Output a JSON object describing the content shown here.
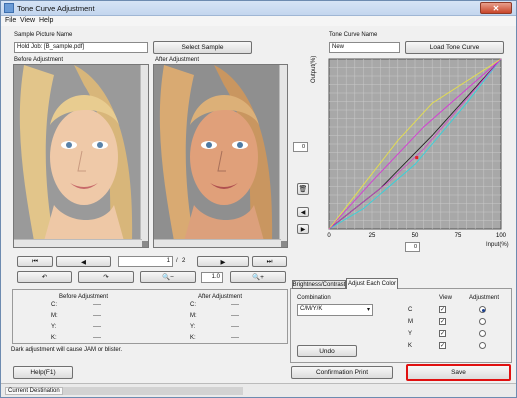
{
  "window": {
    "title": "Tone Curve Adjustment",
    "close_glyph": "✕"
  },
  "menu": {
    "file": "File",
    "view": "View",
    "help": "Help"
  },
  "sample": {
    "label": "Sample Picture Name",
    "value": "Hold Job: [B_sample.pdf]",
    "button": "Select Sample"
  },
  "tone": {
    "label": "Tone Curve Name",
    "value": "New",
    "button": "Load Tone Curve"
  },
  "images": {
    "before": "Before Adjustment",
    "after": "After Adjustment"
  },
  "nav": {
    "first": "⏮",
    "prev": "◀",
    "page_current": "1",
    "page_sep": "/",
    "page_total": "2",
    "next": "▶",
    "last": "⏭"
  },
  "tools": {
    "rotate_left": "↶",
    "rotate_right": "↷",
    "zoom_out": "🔍−",
    "zoom_value": "1.0",
    "zoom_in": "🔍+"
  },
  "values_table": {
    "before_header": "Before Adjustment",
    "after_header": "After Adjustment",
    "rows": [
      {
        "ch": "C:",
        "before": "----",
        "after": "----"
      },
      {
        "ch": "M:",
        "before": "----",
        "after": "----"
      },
      {
        "ch": "Y:",
        "before": "----",
        "after": "----"
      },
      {
        "ch": "K:",
        "before": "----",
        "after": "----"
      }
    ]
  },
  "warning": "Dark adjustment will cause JAM or blister.",
  "graph": {
    "y_label": "Output(%)",
    "x_label": "Input(%)",
    "ticks": [
      "0",
      "25",
      "50",
      "75",
      "100"
    ],
    "y_spinner": "0",
    "x_spinner": "0",
    "grid": true,
    "colors": {
      "cyan": "#34d4dd",
      "magenta": "#d43bd4",
      "yellow": "#e6e04a",
      "black": "#222222",
      "marker": "#e02020"
    }
  },
  "tabs": {
    "brightness": "Brightness/Contrast",
    "adjust": "Adjust Each Color"
  },
  "adjust": {
    "combination_label": "Combination",
    "combination_value": "C/M/Y/K",
    "view_header": "View",
    "adjustment_header": "Adjustment",
    "channels": [
      {
        "name": "C",
        "view": true,
        "selected": true
      },
      {
        "name": "M",
        "view": true,
        "selected": false
      },
      {
        "name": "Y",
        "view": true,
        "selected": false
      },
      {
        "name": "K",
        "view": true,
        "selected": false
      }
    ],
    "undo": "Undo"
  },
  "footer": {
    "help": "Help(F1)",
    "confirm": "Confirmation Print",
    "save": "Save",
    "accent": "#e01010"
  },
  "status": {
    "label": "Current Destination"
  }
}
